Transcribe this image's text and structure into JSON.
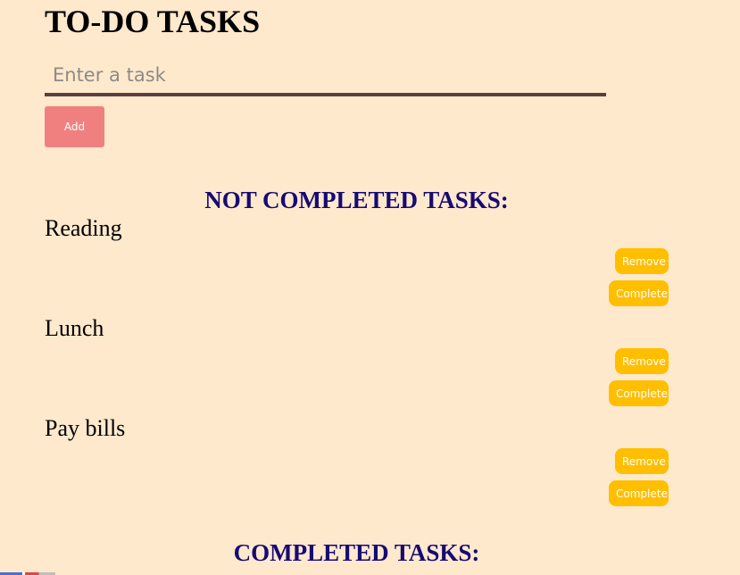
{
  "header": {
    "title": "TO-DO TASKS"
  },
  "input": {
    "placeholder": "Enter a task",
    "value": ""
  },
  "add_button_label": "Add",
  "not_completed_heading": "NOT COMPLETED TASKS:",
  "completed_heading": "COMPLETED TASKS:",
  "tasks": [
    {
      "name": "Reading",
      "remove_label": "Remove",
      "complete_label": "Complete"
    },
    {
      "name": "Lunch",
      "remove_label": "Remove",
      "complete_label": "Complete"
    },
    {
      "name": "Pay bills",
      "remove_label": "Remove",
      "complete_label": "Complete"
    }
  ],
  "completed_tasks": [],
  "colors": {
    "background": "#ffe9cd",
    "heading": "#170a73",
    "add_button": "#f08080",
    "task_button": "#ffbf00",
    "input_underline": "#5a4040"
  }
}
